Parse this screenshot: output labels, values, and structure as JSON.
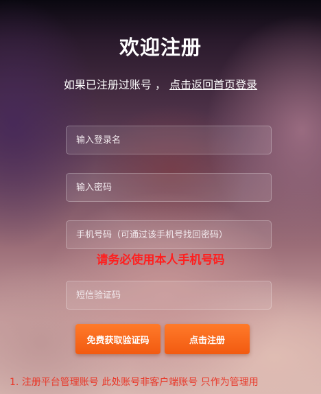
{
  "header": {
    "title": "欢迎注册",
    "subtitle_prefix": "如果已注册过账号 ， ",
    "login_link": "点击返回首页登录"
  },
  "form": {
    "username_placeholder": "输入登录名",
    "password_placeholder": "输入密码",
    "phone_placeholder": "手机号码（可通过该手机号找回密码）",
    "phone_warning": "请务必使用本人手机号码",
    "sms_code_placeholder": "短信验证码"
  },
  "buttons": {
    "get_code": "免费获取验证码",
    "register": "点击注册"
  },
  "notes": [
    "1.  注册平台管理账号  此处账号非客户端账号  只作为管理用"
  ],
  "colors": {
    "accent": "#f25a10",
    "warning": "#ff1e1e",
    "note": "#e8392a"
  }
}
